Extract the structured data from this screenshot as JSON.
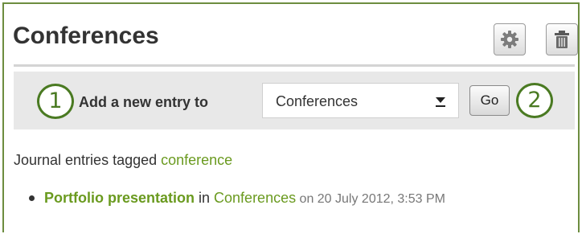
{
  "block": {
    "title": "Conferences",
    "config_icon": "gear-icon",
    "delete_icon": "trash-icon"
  },
  "add_entry": {
    "callout_1": "1",
    "label": "Add a new entry to",
    "selected_blog": "Conferences",
    "go_label": "Go",
    "callout_2": "2"
  },
  "tagged": {
    "prefix": "Journal entries tagged ",
    "tag": "conference"
  },
  "entries": [
    {
      "title": "Portfolio presentation",
      "in_text": " in ",
      "blog": "Conferences",
      "date": " on 20 July 2012, 3:53 PM"
    }
  ],
  "colors": {
    "frame_border": "#6d8d3f",
    "link_green": "#6a9a1f",
    "callout_green": "#4a7a22",
    "bar_background": "#e8e8e8"
  }
}
